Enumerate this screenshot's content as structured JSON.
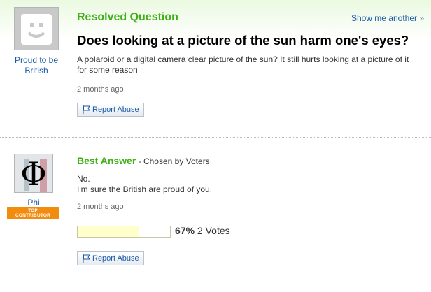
{
  "question": {
    "status_label": "Resolved Question",
    "show_another": "Show me another »",
    "title": "Does looking at a picture of the sun harm one's eyes?",
    "body": "A polaroid or a digital camera clear picture of the sun? It still hurts looking at a picture of it for some reason",
    "time": "2 months ago",
    "report_label": "Report Abuse",
    "asker_name": "Proud to be British"
  },
  "answer": {
    "heading": "Best Answer",
    "chosen_by": " - Chosen by Voters",
    "lines": [
      "No.",
      "I'm sure the British are proud of you."
    ],
    "time": "2 months ago",
    "report_label": "Report Abuse",
    "answerer_name": "Phi",
    "badge_line1": "TOP",
    "badge_line2": "CONTRIBUTOR",
    "vote_percent_value": 0.67,
    "vote_percent": "67%",
    "vote_count": "2 Votes"
  },
  "colors": {
    "accent_green": "#3db015",
    "link_blue": "#1a5aa8",
    "badge_orange": "#f28c0f",
    "vote_fill": "#ffffcc"
  }
}
